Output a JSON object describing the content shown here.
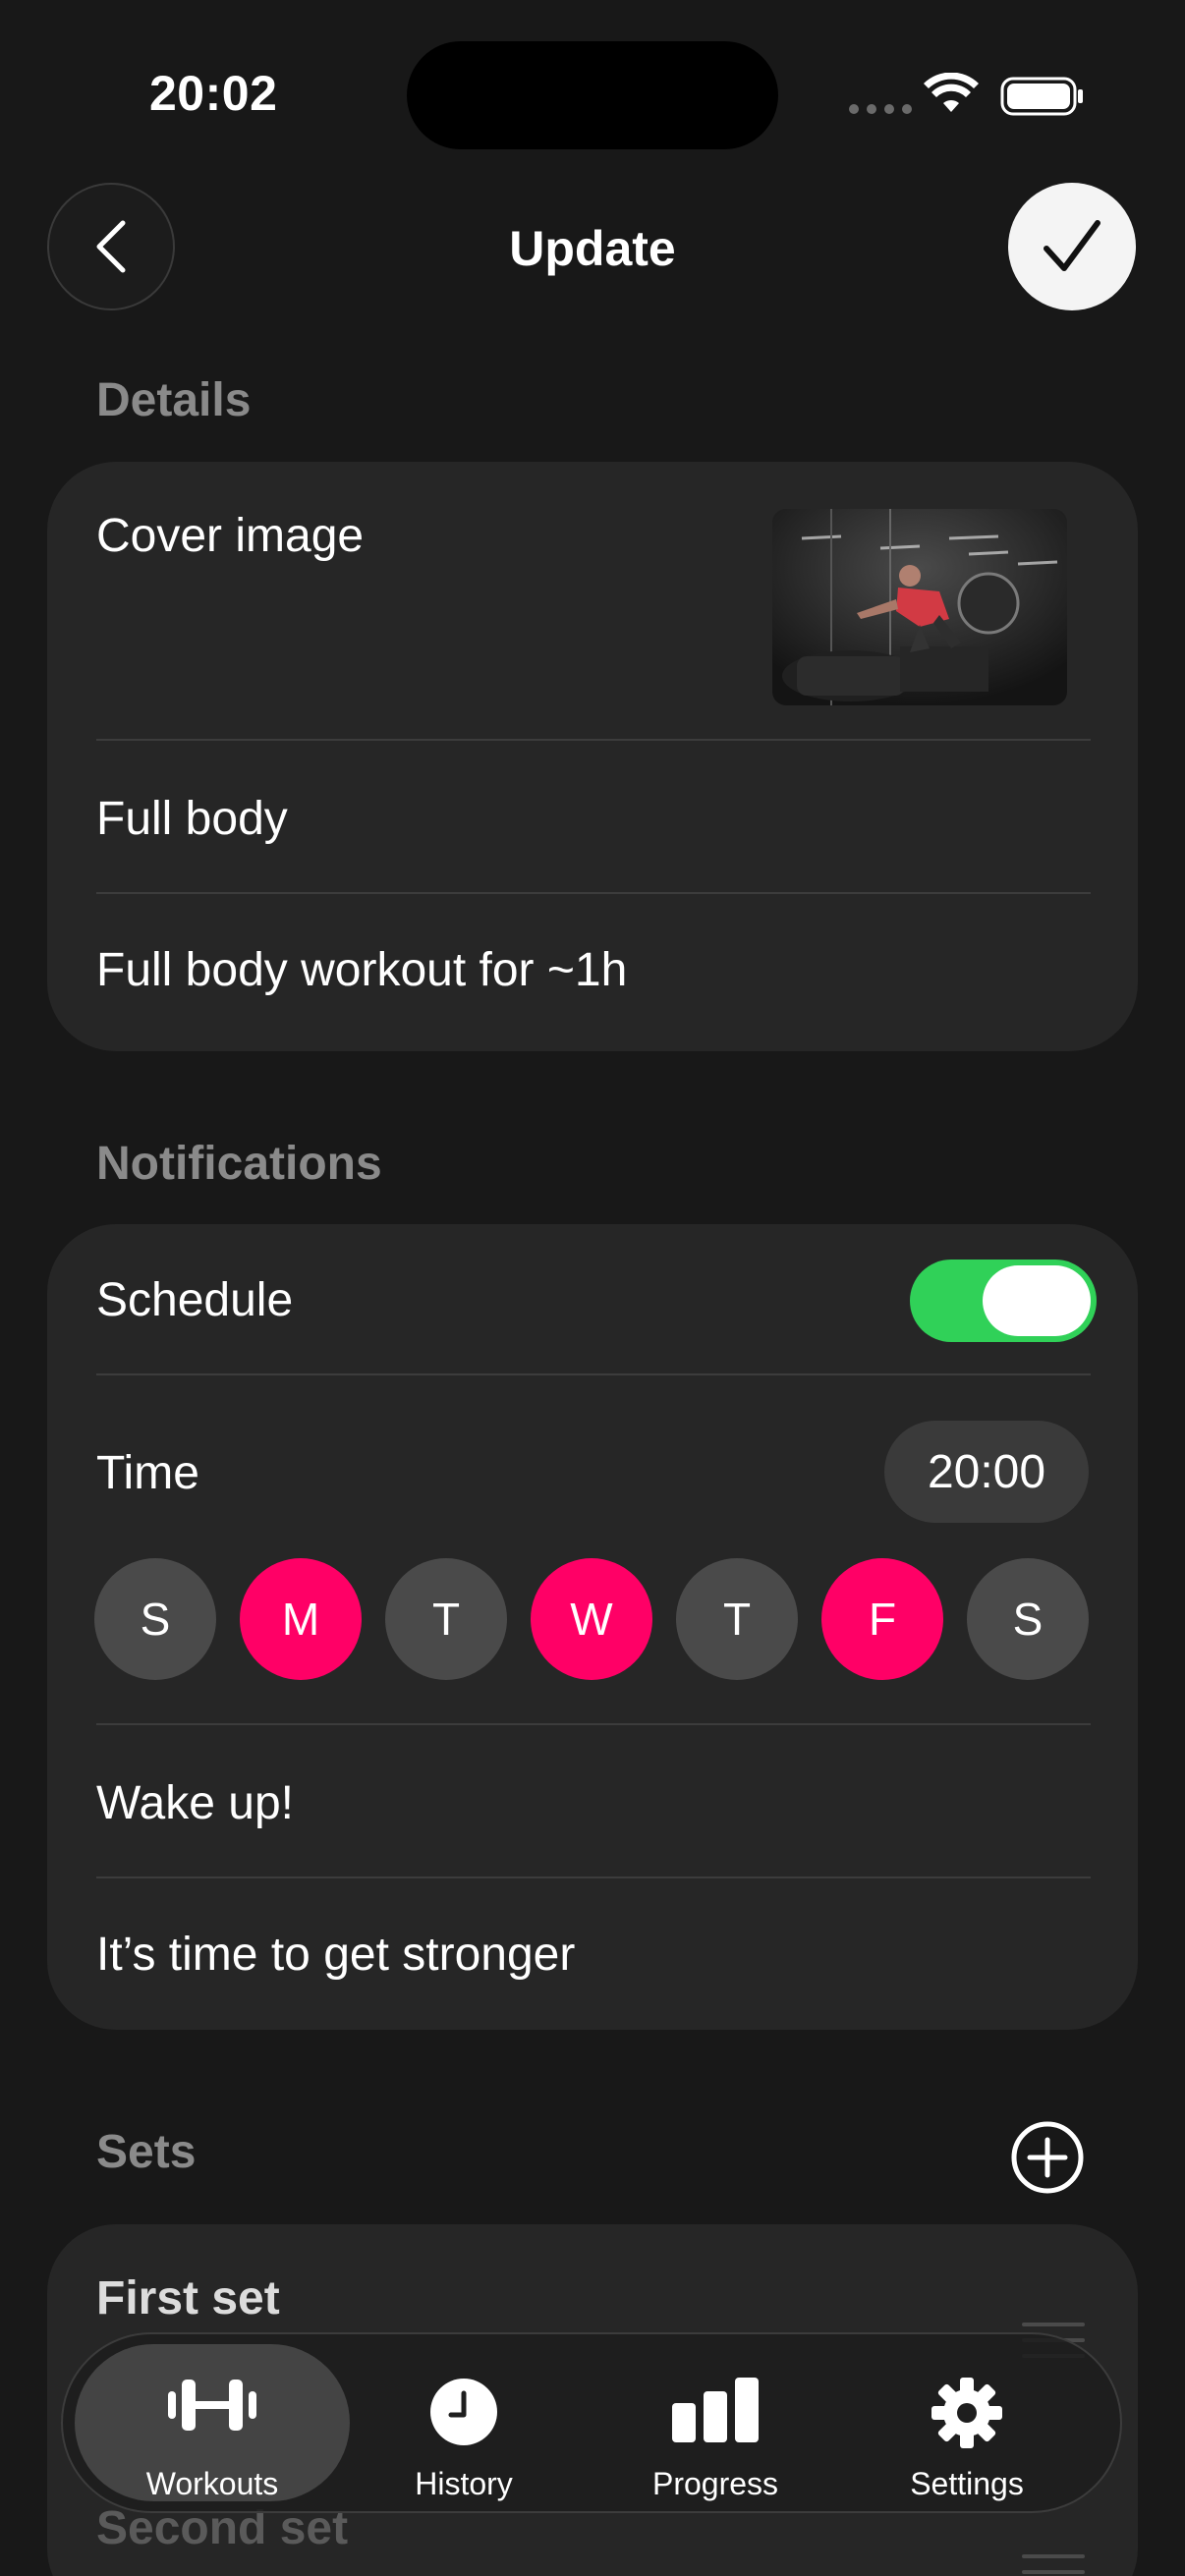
{
  "status_bar": {
    "time": "20:02"
  },
  "header": {
    "title": "Update"
  },
  "details": {
    "section_title": "Details",
    "cover_label": "Cover image",
    "name": "Full body",
    "description": "Full body workout for ~1h"
  },
  "notifications": {
    "section_title": "Notifications",
    "schedule_label": "Schedule",
    "schedule_enabled": true,
    "time_label": "Time",
    "time_value": "20:00",
    "days": [
      {
        "label": "S",
        "active": false
      },
      {
        "label": "M",
        "active": true
      },
      {
        "label": "T",
        "active": false
      },
      {
        "label": "W",
        "active": true
      },
      {
        "label": "T",
        "active": false
      },
      {
        "label": "F",
        "active": true
      },
      {
        "label": "S",
        "active": false
      }
    ],
    "title_text": "Wake up!",
    "body_text": "It’s time to get stronger"
  },
  "sets": {
    "section_title": "Sets",
    "items": [
      {
        "label": "First set"
      },
      {
        "label": "Second set"
      }
    ]
  },
  "tabbar": {
    "tabs": [
      {
        "label": "Workouts",
        "icon": "dumbbell-icon",
        "active": true
      },
      {
        "label": "History",
        "icon": "clock-icon",
        "active": false
      },
      {
        "label": "Progress",
        "icon": "bar-chart-icon",
        "active": false
      },
      {
        "label": "Settings",
        "icon": "gear-icon",
        "active": false
      }
    ]
  },
  "colors": {
    "accent": "#ff0066",
    "toggle_on": "#30d158",
    "card": "#262626",
    "background": "#181818"
  }
}
